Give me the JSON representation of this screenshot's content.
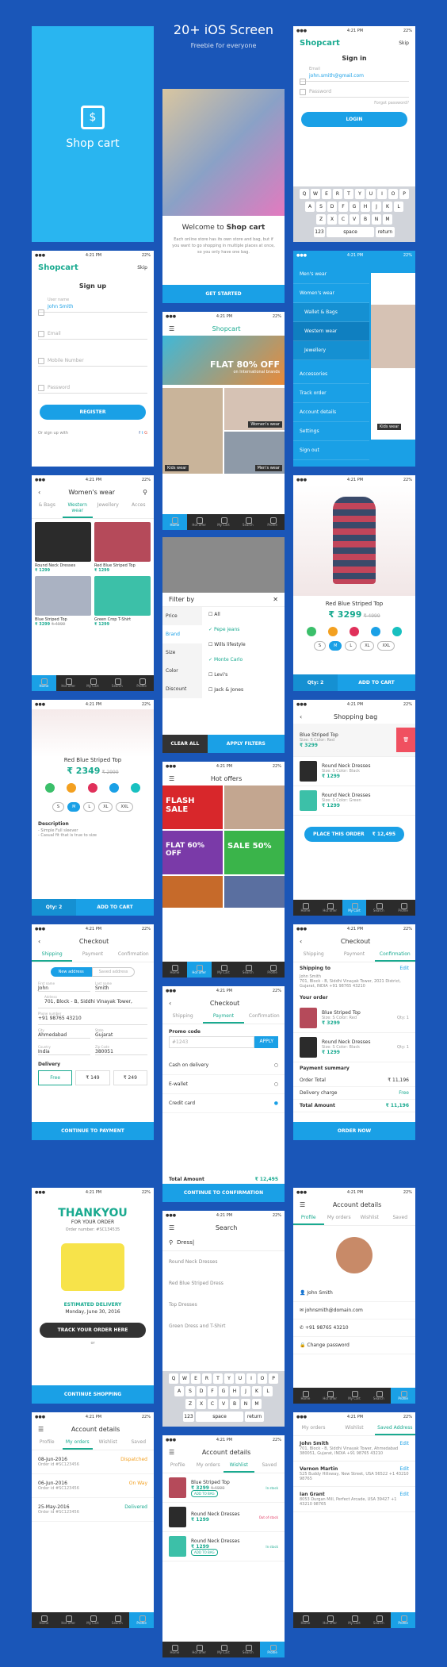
{
  "header": {
    "title": "20+ iOS Screen",
    "subtitle": "Freebie for everyone"
  },
  "status": {
    "time": "4:21 PM",
    "battery": "22%"
  },
  "splash": {
    "app_name": "Shop cart"
  },
  "welcome": {
    "title_prefix": "Welcome to ",
    "title_brand": "Shop cart",
    "body": "Each online store has its own store and bag, but if you want to go shopping in multiple places at once, so you only have one bag.",
    "cta": "GET STARTED"
  },
  "signin": {
    "brand": "Shopcart",
    "skip": "Skip",
    "title": "Sign in",
    "email_label": "Email",
    "email_value": "john.smith@gmail.com",
    "password_placeholder": "Password",
    "forgot": "Forgot password?",
    "login": "LOGIN"
  },
  "keyboard": {
    "row1": [
      "Q",
      "W",
      "E",
      "R",
      "T",
      "Y",
      "U",
      "I",
      "O",
      "P"
    ],
    "row2": [
      "A",
      "S",
      "D",
      "F",
      "G",
      "H",
      "J",
      "K",
      "L"
    ],
    "row3": [
      "Z",
      "X",
      "C",
      "V",
      "B",
      "N",
      "M"
    ],
    "num": "123",
    "space": "space",
    "return": "return"
  },
  "signup": {
    "brand": "Shopcart",
    "skip": "Skip",
    "title": "Sign up",
    "name_label": "User name",
    "name_value": "John Smith",
    "email": "Email",
    "mobile": "Mobile Number",
    "password": "Password",
    "register": "REGISTER",
    "or": "Or sign up with"
  },
  "menu": {
    "items": [
      "Men's wear",
      "Women's wear",
      "Wallet & Bags",
      "Western wear",
      "Jewellery",
      "Accessories",
      "Track order",
      "Account details",
      "Settings",
      "Sign out"
    ],
    "badge": "Kids wear"
  },
  "home": {
    "title": "Shopcart",
    "promo": "FLAT 80% OFF",
    "promo_sub": "on International brands",
    "cat1": "Kids wear",
    "cat2": "Women's wear",
    "cat3": "Men's wear"
  },
  "tabs": {
    "items": [
      "Home",
      "Hot offer",
      "My Cart",
      "Search",
      "Profile"
    ]
  },
  "women": {
    "title": "Women's wear",
    "tabs": [
      "& Bags",
      "Western wear",
      "Jewellery",
      "Acces"
    ],
    "products": [
      {
        "name": "Round Neck Dresses",
        "price": "₹ 1299"
      },
      {
        "name": "Red Blue Striped Top",
        "price": "₹ 1299"
      },
      {
        "name": "Blue Striped Top",
        "price": "₹ 3299",
        "old": "₹ 4999"
      },
      {
        "name": "Green Crop T-Shirt",
        "price": "₹ 1299"
      }
    ]
  },
  "product": {
    "name": "Red Blue Striped Top",
    "price": "₹ 3299",
    "old": "₹ 4999",
    "qty": "Qty: 2",
    "cta": "ADD TO CART",
    "sizes": [
      "S",
      "M",
      "L",
      "XL",
      "XXL"
    ]
  },
  "filter": {
    "title": "Filter by",
    "cats": [
      "Price",
      "Brand",
      "Size",
      "Color",
      "Discount"
    ],
    "options": [
      "All",
      "Pepe jeans",
      "Wills lifestyle",
      "Monte Carlo",
      "Levi's",
      "Jack & Jones"
    ],
    "clear": "CLEAR ALL",
    "apply": "APPLY FILTERS"
  },
  "bag": {
    "title": "Shopping bag",
    "items": [
      {
        "name": "Blue Striped Top",
        "meta": "Size: S  Color: Red",
        "price": "₹ 3299"
      },
      {
        "name": "Round Neck Dresses",
        "meta": "Size: S  Color: Black",
        "price": "₹ 1299"
      },
      {
        "name": "Round Neck Dresses",
        "meta": "Size: S  Color: Green",
        "price": "₹ 1299"
      }
    ],
    "order": "PLACE THIS ORDER",
    "total": "₹ 12,495"
  },
  "product2": {
    "name": "Red Blue Striped Top",
    "price": "₹ 2349",
    "old": "₹ 2999",
    "desc_title": "Description",
    "desc1": "- Simple Full sleever",
    "desc2": "- Casual fit that is true to size",
    "qty": "Qty: 2",
    "cta": "ADD TO CART"
  },
  "hot": {
    "title": "Hot offers",
    "flash": "FLASH SALE",
    "flat": "FLAT 60% OFF",
    "sale": "SALE 50%"
  },
  "checkout": {
    "title": "Checkout",
    "steps": [
      "Shipping",
      "Payment",
      "Confirmation"
    ],
    "new_addr": "New address",
    "saved_addr": "Saved address",
    "first": "First name",
    "first_v": "John",
    "last": "Last name",
    "last_v": "Smith",
    "addr": "Address",
    "addr_v": "701, Block - B, Siddhi Vinayak Tower,",
    "phone": "Phone number",
    "phone_v": "+91 98765 43210",
    "city": "City",
    "city_v": "Ahmedabad",
    "state": "State",
    "state_v": "Gujarat",
    "country": "Country",
    "country_v": "India",
    "zip": "Zip Code",
    "zip_v": "380051",
    "delivery": "Delivery",
    "free": "Free",
    "p149": "₹ 149",
    "p249": "₹ 249",
    "cta": "CONTINUE TO PAYMENT"
  },
  "payment": {
    "title": "Checkout",
    "promo": "Promo code",
    "promo_v": "#1243",
    "apply": "APPLY",
    "opts": [
      "Cash on delivery",
      "E-wallet",
      "Credit card"
    ],
    "total_l": "Total Amount",
    "total": "₹ 12,495",
    "cta": "CONTINUE TO CONFIRMATION"
  },
  "confirm": {
    "title": "Checkout",
    "ship_to": "Shipping to",
    "edit": "Edit",
    "name": "John Smith",
    "addr": "701, Block - B, Siddhi Vinayak Tower, 2021 District, Gujarat, INDIA +91 98765 43210",
    "your_order": "Your order",
    "items": [
      {
        "name": "Blue Striped Top",
        "meta": "Size: S  Color: Red",
        "price": "₹ 3299",
        "qty": "Qty: 1"
      },
      {
        "name": "Round Neck Dresses",
        "meta": "Size: S  Color: Black",
        "price": "₹ 1299",
        "qty": "Qty: 1"
      }
    ],
    "summary": "Payment summary",
    "total_l": "Order Total",
    "total": "₹ 11,196",
    "del_l": "Delivery charge",
    "del": "Free",
    "amt_l": "Total Amount",
    "amt": "₹ 11,196",
    "cta": "ORDER NOW"
  },
  "thanks": {
    "title": "THANKYOU",
    "sub": "FOR YOUR ORDER",
    "order": "Order number: #SC134535",
    "est": "ESTIMATED DELIVERY",
    "date": "Monday, June 30, 2016",
    "track": "TRACK YOUR ORDER HERE",
    "or": "or",
    "cta": "CONTINUE SHOPPING"
  },
  "search": {
    "title": "Search",
    "query": "Dress|",
    "results": [
      "Round Neck Dresses",
      "Red Blue Striped Dress",
      "Top Dresses",
      "Green Dress and T-Shirt"
    ]
  },
  "account": {
    "title": "Account details",
    "tabs": [
      "Profile",
      "My orders",
      "Wishlist",
      "Saved"
    ],
    "name": "John Smith",
    "email": "johnsmith@domain.com",
    "phone": "+91 98765 43210",
    "pwd": "Change password"
  },
  "orders": {
    "title": "Account details",
    "tabs": [
      "Profile",
      "My orders",
      "Wishlist",
      "Saved"
    ],
    "rows": [
      {
        "date": "08-Jun-2016",
        "id": "Order id #SC123456",
        "status": "Dispatched"
      },
      {
        "date": "06-Jun-2016",
        "id": "Order id #SC123456",
        "status": "On Way"
      },
      {
        "date": "25-May-2016",
        "id": "Order id #SC123456",
        "status": "Delivered"
      }
    ]
  },
  "wish": {
    "title": "Account details",
    "tabs": [
      "Profile",
      "My orders",
      "Wishlist",
      "Saved"
    ],
    "items": [
      {
        "name": "Blue Striped Top",
        "price": "₹ 3299",
        "old": "₹ 4999",
        "stock": "In stock"
      },
      {
        "name": "Round Neck Dresses",
        "price": "₹ 1299",
        "stock": "Out of stock"
      },
      {
        "name": "Round Neck Dresses",
        "price": "₹ 1299",
        "stock": "In stock"
      }
    ],
    "add": "ADD TO BAG"
  },
  "saved": {
    "title": "Account details",
    "tabs": [
      "My orders",
      "Wishlist",
      "Saved Address"
    ],
    "addrs": [
      {
        "name": "John Smith",
        "addr": "701, Block - B, Siddhi Vinayak Tower, Ahmedabad 380051, Gujarat, INDIA +91 98765 43210"
      },
      {
        "name": "Vernon Martin",
        "addr": "525 Buddy Hillsway, New Street, USA 56522 +1 43210 98765"
      },
      {
        "name": "Ian Grant",
        "addr": "8053 Durgan Mill, Perfect Arcade, USA 39427 +1 43210 98765"
      }
    ],
    "edit": "Edit"
  }
}
